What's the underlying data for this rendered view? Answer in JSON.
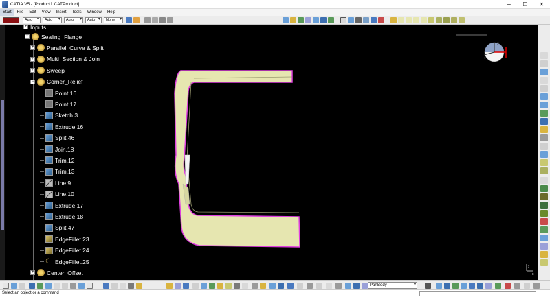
{
  "window": {
    "title": "CATIA V5 - [Product1.CATProduct]",
    "minimize": "─",
    "maximize": "☐",
    "close": "✕"
  },
  "menu": [
    "Start",
    "File",
    "Edit",
    "View",
    "Insert",
    "Tools",
    "Window",
    "Help"
  ],
  "graphic_props": {
    "color_hex": "#8a0f12",
    "transparency": "Auto",
    "line_thickness": "Auto",
    "line_type": "Auto",
    "point_type": "Auto",
    "layer": "None"
  },
  "tree": {
    "top_node": "Inputs",
    "nodes": [
      {
        "label": "Sealing_Flange",
        "icon": "gear-icon"
      },
      {
        "label": "Parallel_Curve & Split",
        "icon": "gear-icon"
      },
      {
        "label": "Multi_Section & Join",
        "icon": "gear-icon"
      },
      {
        "label": "Sweep",
        "icon": "gear-icon"
      },
      {
        "label": "Corner_Relief",
        "icon": "gear-icon"
      },
      {
        "label": "Point.16",
        "icon": "point-icon"
      },
      {
        "label": "Point.17",
        "icon": "point-icon"
      },
      {
        "label": "Sketch.3",
        "icon": "sketch-icon"
      },
      {
        "label": "Extrude.16",
        "icon": "extrude-icon"
      },
      {
        "label": "Split.46",
        "icon": "split-icon"
      },
      {
        "label": "Join.18",
        "icon": "join-icon"
      },
      {
        "label": "Trim.12",
        "icon": "trim-icon"
      },
      {
        "label": "Trim.13",
        "icon": "trim-icon"
      },
      {
        "label": "Line.9",
        "icon": "line-icon"
      },
      {
        "label": "Line.10",
        "icon": "line-icon"
      },
      {
        "label": "Extrude.17",
        "icon": "extrude-icon"
      },
      {
        "label": "Extrude.18",
        "icon": "extrude-icon"
      },
      {
        "label": "Split.47",
        "icon": "split-icon"
      },
      {
        "label": "EdgeFillet.23",
        "icon": "fillet-icon"
      },
      {
        "label": "EdgeFillet.24",
        "icon": "fillet-icon"
      },
      {
        "label": "EdgeFillet.25",
        "icon": "fillet-moon-icon"
      },
      {
        "label": "Center_Offset",
        "icon": "gear-icon"
      }
    ]
  },
  "bottom_toolbar": {
    "body_selector": "PartBody"
  },
  "status": {
    "message": "Select an object or a command"
  },
  "viewport": {
    "background": "#000000",
    "surface_fill": "#e6e6b0",
    "highlight_edge": "#e040e0",
    "compass_axes": [
      "x",
      "y",
      "z"
    ]
  }
}
